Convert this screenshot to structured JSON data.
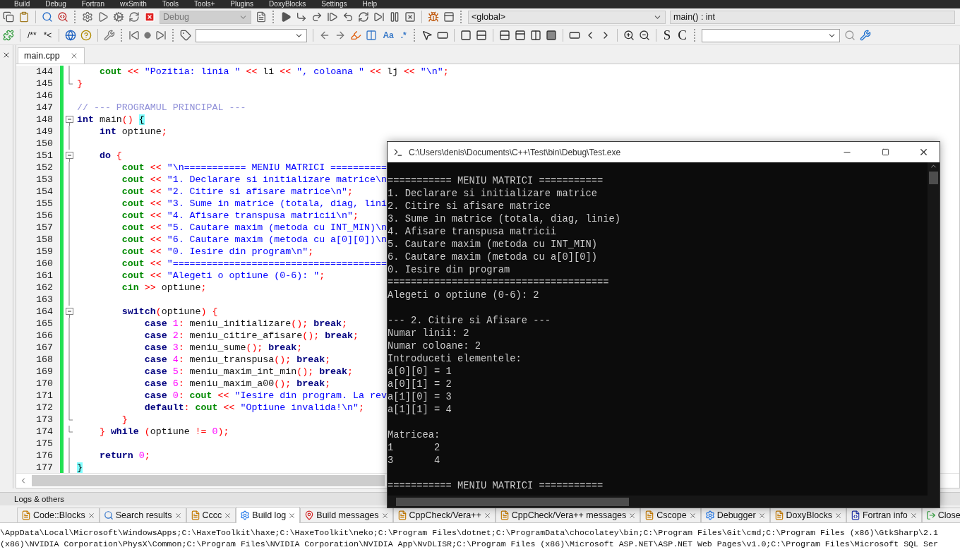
{
  "menu_bar": [
    "Build",
    "Debug",
    "Fortran",
    "wxSmith",
    "Tools",
    "Tools+",
    "Plugins",
    "DoxyBlocks",
    "Settings",
    "Help"
  ],
  "toolbar": {
    "build_target": {
      "value": "Debug",
      "disabled": true
    },
    "scope": {
      "value": "<global>"
    },
    "symbol": {
      "value": "main() : int"
    },
    "comment_buttons": [
      "/**",
      "*<"
    ],
    "search_buttons": [
      "Aa",
      ".*"
    ],
    "syntax_buttons": [
      "S",
      "C"
    ]
  },
  "editor": {
    "tabs": [
      {
        "label": "main.cpp",
        "selected": true
      }
    ],
    "lines": [
      {
        "no": "144",
        "fold_marker": {
          "kind": "line"
        },
        "changed": true,
        "tokens": [
          {
            "kind": "io",
            "text": "    cout "
          },
          {
            "kind": "op",
            "text": "<< "
          },
          {
            "kind": "str",
            "text": "\"Pozitia: linia \" "
          },
          {
            "kind": "op",
            "text": "<<"
          },
          {
            "kind": "plain",
            "text": " li "
          },
          {
            "kind": "op",
            "text": "<< "
          },
          {
            "kind": "str",
            "text": "\", coloana \" "
          },
          {
            "kind": "op",
            "text": "<<"
          },
          {
            "kind": "plain",
            "text": " lj "
          },
          {
            "kind": "op",
            "text": "<< "
          },
          {
            "kind": "str",
            "text": "\"\\n\""
          },
          {
            "kind": "op",
            "text": ";"
          }
        ]
      },
      {
        "no": "145",
        "fold_marker": {
          "kind": "end"
        },
        "changed": true,
        "tokens": [
          {
            "kind": "op",
            "text": "}"
          }
        ]
      },
      {
        "no": "146",
        "fold_marker": {
          "kind": "none"
        },
        "changed": true
      },
      {
        "no": "147",
        "fold_marker": {
          "kind": "none"
        },
        "changed": true,
        "tokens": [
          {
            "kind": "comment",
            "text": "// --- PROGRAMUL PRINCIPAL ---"
          }
        ]
      },
      {
        "no": "148",
        "fold_marker": {
          "kind": "start"
        },
        "changed": true,
        "tokens": [
          {
            "kind": "kw",
            "text": "int"
          },
          {
            "kind": "plain",
            "text": " main"
          },
          {
            "kind": "op",
            "text": "() "
          },
          {
            "kind": "match",
            "text": "{"
          }
        ]
      },
      {
        "no": "149",
        "fold_marker": {
          "kind": "line"
        },
        "changed": true,
        "tokens": [
          {
            "kind": "kw",
            "text": "    int"
          },
          {
            "kind": "plain",
            "text": " optiune"
          },
          {
            "kind": "op",
            "text": ";"
          }
        ]
      },
      {
        "no": "150",
        "fold_marker": {
          "kind": "line"
        },
        "changed": true
      },
      {
        "no": "151",
        "fold_marker": {
          "kind": "start"
        },
        "changed": true,
        "tokens": [
          {
            "kind": "kw",
            "text": "    do "
          },
          {
            "kind": "op",
            "text": "{"
          }
        ]
      },
      {
        "no": "152",
        "fold_marker": {
          "kind": "line"
        },
        "changed": true,
        "tokens": [
          {
            "kind": "io",
            "text": "        cout "
          },
          {
            "kind": "op",
            "text": "<< "
          },
          {
            "kind": "str",
            "text": "\"\\n=========== MENIU MATRICI =========="
          }
        ]
      },
      {
        "no": "153",
        "fold_marker": {
          "kind": "line"
        },
        "changed": true,
        "tokens": [
          {
            "kind": "io",
            "text": "        cout "
          },
          {
            "kind": "op",
            "text": "<< "
          },
          {
            "kind": "str",
            "text": "\"1. Declarare si initializare matrice\\n"
          }
        ]
      },
      {
        "no": "154",
        "fold_marker": {
          "kind": "line"
        },
        "changed": true,
        "tokens": [
          {
            "kind": "io",
            "text": "        cout "
          },
          {
            "kind": "op",
            "text": "<< "
          },
          {
            "kind": "str",
            "text": "\"2. Citire si afisare matrice\\n\""
          },
          {
            "kind": "op",
            "text": ";"
          }
        ]
      },
      {
        "no": "155",
        "fold_marker": {
          "kind": "line"
        },
        "changed": true,
        "tokens": [
          {
            "kind": "io",
            "text": "        cout "
          },
          {
            "kind": "op",
            "text": "<< "
          },
          {
            "kind": "str",
            "text": "\"3. Sume in matrice (totala, diag, lini"
          }
        ]
      },
      {
        "no": "156",
        "fold_marker": {
          "kind": "line"
        },
        "changed": true,
        "tokens": [
          {
            "kind": "io",
            "text": "        cout "
          },
          {
            "kind": "op",
            "text": "<< "
          },
          {
            "kind": "str",
            "text": "\"4. Afisare transpusa matricii\\n\""
          },
          {
            "kind": "op",
            "text": ";"
          }
        ]
      },
      {
        "no": "157",
        "fold_marker": {
          "kind": "line"
        },
        "changed": true,
        "tokens": [
          {
            "kind": "io",
            "text": "        cout "
          },
          {
            "kind": "op",
            "text": "<< "
          },
          {
            "kind": "str",
            "text": "\"5. Cautare maxim (metoda cu INT_MIN)\\n"
          }
        ]
      },
      {
        "no": "158",
        "fold_marker": {
          "kind": "line"
        },
        "changed": true,
        "tokens": [
          {
            "kind": "io",
            "text": "        cout "
          },
          {
            "kind": "op",
            "text": "<< "
          },
          {
            "kind": "str",
            "text": "\"6. Cautare maxim (metoda cu a[0][0])\\n"
          }
        ]
      },
      {
        "no": "159",
        "fold_marker": {
          "kind": "line"
        },
        "changed": true,
        "tokens": [
          {
            "kind": "io",
            "text": "        cout "
          },
          {
            "kind": "op",
            "text": "<< "
          },
          {
            "kind": "str",
            "text": "\"0. Iesire din program\\n\""
          },
          {
            "kind": "op",
            "text": ";"
          }
        ]
      },
      {
        "no": "160",
        "fold_marker": {
          "kind": "line"
        },
        "changed": true,
        "tokens": [
          {
            "kind": "io",
            "text": "        cout "
          },
          {
            "kind": "op",
            "text": "<< "
          },
          {
            "kind": "str",
            "text": "\"======================================"
          }
        ]
      },
      {
        "no": "161",
        "fold_marker": {
          "kind": "line"
        },
        "changed": true,
        "tokens": [
          {
            "kind": "io",
            "text": "        cout "
          },
          {
            "kind": "op",
            "text": "<< "
          },
          {
            "kind": "str",
            "text": "\"Alegeti o optiune (0-6): \""
          },
          {
            "kind": "op",
            "text": ";"
          }
        ]
      },
      {
        "no": "162",
        "fold_marker": {
          "kind": "line"
        },
        "changed": true,
        "tokens": [
          {
            "kind": "io",
            "text": "        cin "
          },
          {
            "kind": "op",
            "text": ">>"
          },
          {
            "kind": "plain",
            "text": " optiune"
          },
          {
            "kind": "op",
            "text": ";"
          }
        ]
      },
      {
        "no": "163",
        "fold_marker": {
          "kind": "line"
        },
        "changed": true
      },
      {
        "no": "164",
        "fold_marker": {
          "kind": "start"
        },
        "changed": true,
        "tokens": [
          {
            "kind": "kw",
            "text": "        switch"
          },
          {
            "kind": "op",
            "text": "("
          },
          {
            "kind": "plain",
            "text": "optiune"
          },
          {
            "kind": "op",
            "text": ") {"
          }
        ]
      },
      {
        "no": "165",
        "fold_marker": {
          "kind": "line"
        },
        "changed": true,
        "tokens": [
          {
            "kind": "kw",
            "text": "            case "
          },
          {
            "kind": "num",
            "text": "1"
          },
          {
            "kind": "op",
            "text": ":"
          },
          {
            "kind": "plain",
            "text": " meniu_initializare"
          },
          {
            "kind": "op",
            "text": "(); "
          },
          {
            "kind": "kw",
            "text": "break"
          },
          {
            "kind": "op",
            "text": ";"
          }
        ]
      },
      {
        "no": "166",
        "fold_marker": {
          "kind": "line"
        },
        "changed": true,
        "tokens": [
          {
            "kind": "kw",
            "text": "            case "
          },
          {
            "kind": "num",
            "text": "2"
          },
          {
            "kind": "op",
            "text": ":"
          },
          {
            "kind": "plain",
            "text": " meniu_citire_afisare"
          },
          {
            "kind": "op",
            "text": "(); "
          },
          {
            "kind": "kw",
            "text": "break"
          },
          {
            "kind": "op",
            "text": ";"
          }
        ]
      },
      {
        "no": "167",
        "fold_marker": {
          "kind": "line"
        },
        "changed": true,
        "tokens": [
          {
            "kind": "kw",
            "text": "            case "
          },
          {
            "kind": "num",
            "text": "3"
          },
          {
            "kind": "op",
            "text": ":"
          },
          {
            "kind": "plain",
            "text": " meniu_sume"
          },
          {
            "kind": "op",
            "text": "(); "
          },
          {
            "kind": "kw",
            "text": "break"
          },
          {
            "kind": "op",
            "text": ";"
          }
        ]
      },
      {
        "no": "168",
        "fold_marker": {
          "kind": "line"
        },
        "changed": true,
        "tokens": [
          {
            "kind": "kw",
            "text": "            case "
          },
          {
            "kind": "num",
            "text": "4"
          },
          {
            "kind": "op",
            "text": ":"
          },
          {
            "kind": "plain",
            "text": " meniu_transpusa"
          },
          {
            "kind": "op",
            "text": "(); "
          },
          {
            "kind": "kw",
            "text": "break"
          },
          {
            "kind": "op",
            "text": ";"
          }
        ]
      },
      {
        "no": "169",
        "fold_marker": {
          "kind": "line"
        },
        "changed": true,
        "tokens": [
          {
            "kind": "kw",
            "text": "            case "
          },
          {
            "kind": "num",
            "text": "5"
          },
          {
            "kind": "op",
            "text": ":"
          },
          {
            "kind": "plain",
            "text": " meniu_maxim_int_min"
          },
          {
            "kind": "op",
            "text": "(); "
          },
          {
            "kind": "kw",
            "text": "break"
          },
          {
            "kind": "op",
            "text": ";"
          }
        ]
      },
      {
        "no": "170",
        "fold_marker": {
          "kind": "line"
        },
        "changed": true,
        "tokens": [
          {
            "kind": "kw",
            "text": "            case "
          },
          {
            "kind": "num",
            "text": "6"
          },
          {
            "kind": "op",
            "text": ":"
          },
          {
            "kind": "plain",
            "text": " meniu_maxim_a00"
          },
          {
            "kind": "op",
            "text": "(); "
          },
          {
            "kind": "kw",
            "text": "break"
          },
          {
            "kind": "op",
            "text": ";"
          }
        ]
      },
      {
        "no": "171",
        "fold_marker": {
          "kind": "line"
        },
        "changed": true,
        "tokens": [
          {
            "kind": "kw",
            "text": "            case "
          },
          {
            "kind": "num",
            "text": "0"
          },
          {
            "kind": "op",
            "text": ": "
          },
          {
            "kind": "io",
            "text": "cout "
          },
          {
            "kind": "op",
            "text": "<< "
          },
          {
            "kind": "str",
            "text": "\"Iesire din program. La rev"
          }
        ]
      },
      {
        "no": "172",
        "fold_marker": {
          "kind": "line"
        },
        "changed": true,
        "tokens": [
          {
            "kind": "kw",
            "text": "            default"
          },
          {
            "kind": "op",
            "text": ": "
          },
          {
            "kind": "io",
            "text": "cout "
          },
          {
            "kind": "op",
            "text": "<< "
          },
          {
            "kind": "str",
            "text": "\"Optiune invalida!\\n\""
          },
          {
            "kind": "op",
            "text": ";"
          }
        ]
      },
      {
        "no": "173",
        "fold_marker": {
          "kind": "end"
        },
        "changed": true,
        "tokens": [
          {
            "kind": "op",
            "text": "        }"
          }
        ]
      },
      {
        "no": "174",
        "fold_marker": {
          "kind": "end"
        },
        "changed": true,
        "tokens": [
          {
            "kind": "op",
            "text": "    } "
          },
          {
            "kind": "kw",
            "text": "while "
          },
          {
            "kind": "op",
            "text": "("
          },
          {
            "kind": "plain",
            "text": "optiune "
          },
          {
            "kind": "op",
            "text": "!= "
          },
          {
            "kind": "num",
            "text": "0"
          },
          {
            "kind": "op",
            "text": ");"
          }
        ]
      },
      {
        "no": "175",
        "fold_marker": {
          "kind": "line"
        },
        "changed": true
      },
      {
        "no": "176",
        "fold_marker": {
          "kind": "line"
        },
        "changed": true,
        "tokens": [
          {
            "kind": "kw",
            "text": "    return "
          },
          {
            "kind": "num",
            "text": "0"
          },
          {
            "kind": "op",
            "text": ";"
          }
        ]
      },
      {
        "no": "177",
        "fold_marker": {
          "kind": "line"
        },
        "changed": true,
        "tokens": [
          {
            "kind": "match",
            "text": "}"
          }
        ]
      }
    ]
  },
  "console": {
    "title": "C:\\Users\\denis\\Documents\\C++\\Test\\bin\\Debug\\Test.exe",
    "lines": [
      {
        "kind": "blank"
      },
      {
        "kind": "text",
        "text": "=========== MENIU MATRICI ==========="
      },
      {
        "kind": "text",
        "text": "1. Declarare si initializare matrice"
      },
      {
        "kind": "text",
        "text": "2. Citire si afisare matrice"
      },
      {
        "kind": "text",
        "text": "3. Sume in matrice (totala, diag, linie)"
      },
      {
        "kind": "text",
        "text": "4. Afisare transpusa matricii"
      },
      {
        "kind": "text",
        "text": "5. Cautare maxim (metoda cu INT_MIN)"
      },
      {
        "kind": "text",
        "text": "6. Cautare maxim (metoda cu a[0][0])"
      },
      {
        "kind": "text",
        "text": "0. Iesire din program"
      },
      {
        "kind": "text",
        "text": "======================================"
      },
      {
        "kind": "text",
        "text": "Alegeti o optiune (0-6): 2"
      },
      {
        "kind": "blank"
      },
      {
        "kind": "text",
        "text": "--- 2. Citire si Afisare ---"
      },
      {
        "kind": "text",
        "text": "Numar linii: 2"
      },
      {
        "kind": "text",
        "text": "Numar coloane: 2"
      },
      {
        "kind": "text",
        "text": "Introduceti elementele:"
      },
      {
        "kind": "text",
        "text": "a[0][0] = 1"
      },
      {
        "kind": "text",
        "text": "a[0][1] = 2"
      },
      {
        "kind": "text",
        "text": "a[1][0] = 3"
      },
      {
        "kind": "text",
        "text": "a[1][1] = 4"
      },
      {
        "kind": "blank"
      },
      {
        "kind": "text",
        "text": "Matricea:"
      },
      {
        "kind": "text",
        "text": "1       2"
      },
      {
        "kind": "text",
        "text": "3       4"
      },
      {
        "kind": "blank"
      },
      {
        "kind": "text",
        "text": "=========== MENIU MATRICI ==========="
      }
    ]
  },
  "logs": {
    "title": "Logs & others",
    "tabs": [
      {
        "label": "Code::Blocks",
        "selected": false,
        "closable": true
      },
      {
        "label": "Search results",
        "selected": false,
        "closable": true
      },
      {
        "label": "Cccc",
        "selected": false,
        "closable": true
      },
      {
        "label": "Build log",
        "selected": true,
        "closable": true
      },
      {
        "label": "Build messages",
        "selected": false,
        "closable": true
      },
      {
        "label": "CppCheck/Vera++",
        "selected": false,
        "closable": true
      },
      {
        "label": "CppCheck/Vera++ messages",
        "selected": false,
        "closable": true
      },
      {
        "label": "Cscope",
        "selected": false,
        "closable": true
      },
      {
        "label": "Debugger",
        "selected": false,
        "closable": true
      },
      {
        "label": "DoxyBlocks",
        "selected": false,
        "closable": true
      },
      {
        "label": "Fortran info",
        "selected": false,
        "closable": true
      },
      {
        "label": "Close",
        "selected": false,
        "closable": false
      }
    ],
    "output": [
      "\\AppData\\Local\\Microsoft\\WindowsApps;C:\\HaxeToolkit\\haxe;C:\\HaxeToolkit\\neko;C:\\Program Files\\dotnet;C:\\ProgramData\\chocolatey\\bin;C:\\Program Files\\Git\\cmd;C:\\Program Files (x86)\\GtkSharp\\2.1",
      "(x86)\\NVIDIA Corporation\\PhysX\\Common;C:\\Program Files\\NVIDIA Corporation\\NVIDIA App\\NvDLISR;C:\\Program Files (x86)\\Microsoft ASP.NET\\ASP.NET Web Pages\\v1.0;C:\\Program Files\\Microsoft SQL Ser"
    ]
  }
}
